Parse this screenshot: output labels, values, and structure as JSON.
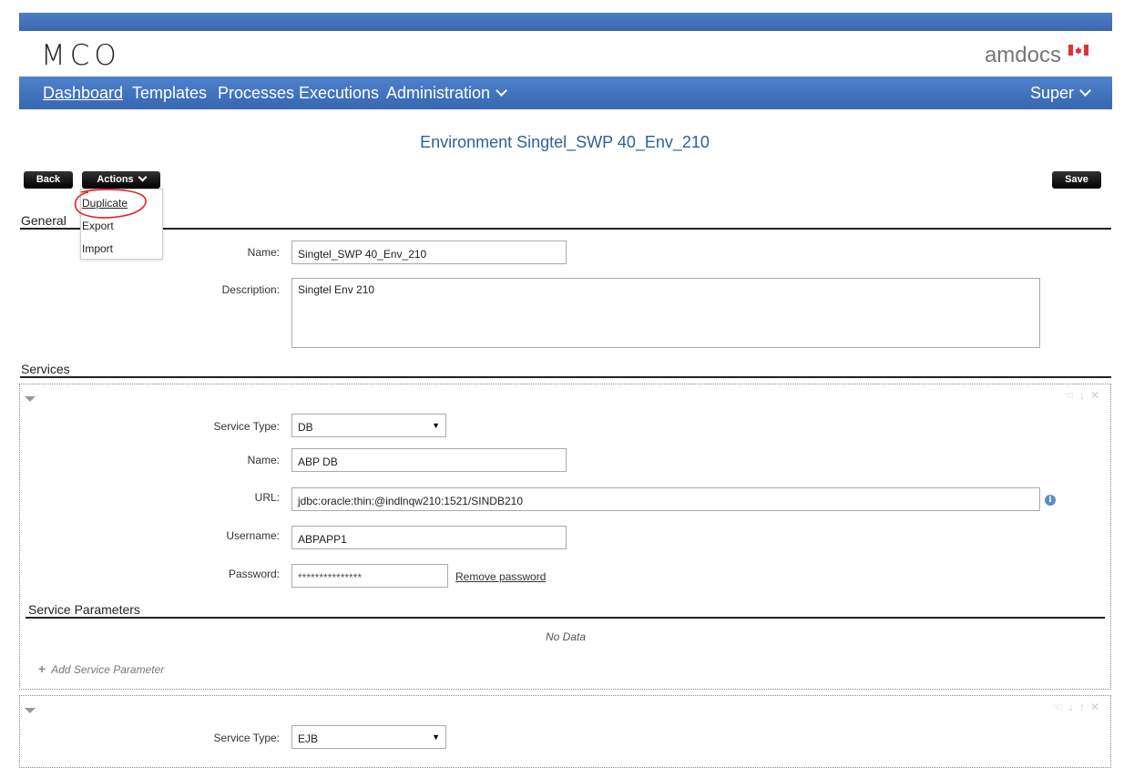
{
  "header": {
    "logo": "MCO",
    "brand": "amdocs",
    "nav": [
      "Dashboard",
      "Templates",
      "Processes",
      "Executions",
      "Administration"
    ],
    "user": "Super"
  },
  "page": {
    "title": "Environment Singtel_SWP 40_Env_210"
  },
  "toolbar": {
    "back": "Back",
    "actions": "Actions",
    "save": "Save",
    "menu": [
      "Duplicate",
      "Export",
      "Import"
    ]
  },
  "general": {
    "heading": "General",
    "name_label": "Name:",
    "name_value": "Singtel_SWP 40_Env_210",
    "desc_label": "Description:",
    "desc_value": "Singtel Env 210"
  },
  "services": {
    "heading": "Services",
    "items": [
      {
        "type_label": "Service Type:",
        "type": "DB",
        "name_label": "Name:",
        "name": "ABP DB",
        "url_label": "URL:",
        "url": "jdbc:oracle:thin:@indlnqw210:1521/SINDB210",
        "user_label": "Username:",
        "user": "ABPAPP1",
        "pass_label": "Password:",
        "pass": "***************",
        "remove_password": "Remove password",
        "params_heading": "Service Parameters",
        "no_data": "No Data",
        "add_param": "Add Service Parameter"
      },
      {
        "type_label": "Service Type:",
        "type": "EJB"
      }
    ]
  }
}
